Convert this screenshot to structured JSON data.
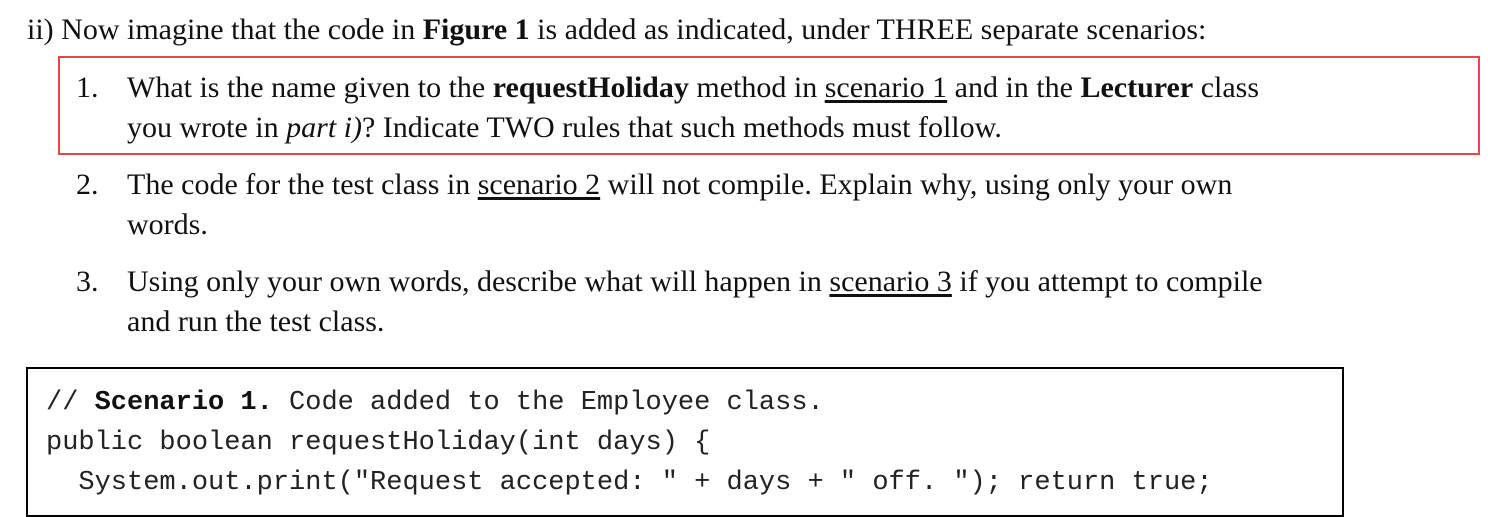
{
  "intro": {
    "prefix": "ii) Now imagine that the code in ",
    "figure_ref": "Figure 1",
    "suffix": " is added as indicated, under THREE separate scenarios:"
  },
  "questions": [
    {
      "number": "1.",
      "line1_a": "What is the name given to the ",
      "line1_b": "requestHoliday",
      "line1_c": " method in ",
      "line1_d": "scenario 1",
      "line1_e": " and in the ",
      "line1_f": "Lecturer",
      "line1_g": " class",
      "line2_a": "you wrote in ",
      "line2_b": "part i)",
      "line2_c": "? Indicate TWO rules that such methods must follow."
    },
    {
      "number": "2.",
      "line1_a": "The code for the test class in ",
      "line1_b": "scenario 2",
      "line1_c": " will not compile. Explain why, using only your own",
      "line2_a": "words."
    },
    {
      "number": "3.",
      "line1_a": "Using only your own words, describe what will happen in ",
      "line1_b": "scenario 3",
      "line1_c": " if you attempt to compile",
      "line2_a": "and run the test class."
    }
  ],
  "code": {
    "line1_comment": "// ",
    "line1_bold": "Scenario 1.",
    "line1_rest": " Code added to the Employee class.",
    "line2": "public boolean requestHoliday(int days) {",
    "line3": "  System.out.print(\"Request accepted: \" + days + \" off. \"); return true;"
  },
  "colors": {
    "highlight_border": "#e8464b"
  }
}
